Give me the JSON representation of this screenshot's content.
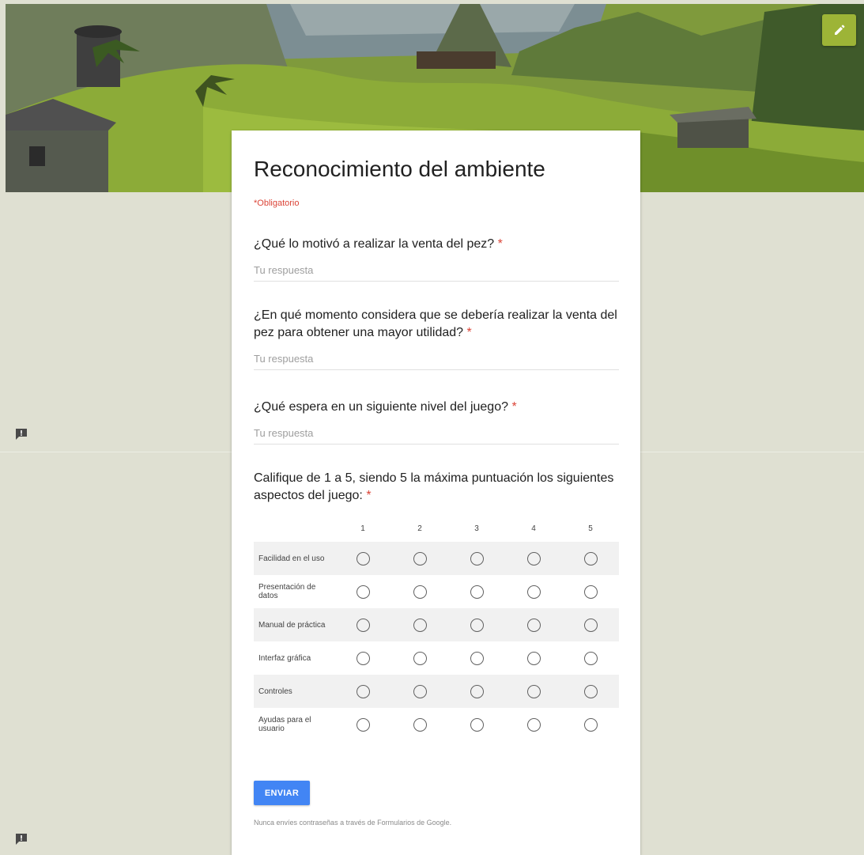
{
  "header": {
    "edit_icon": "pencil-icon",
    "accent_color": "#9db437"
  },
  "form": {
    "title": "Reconocimiento del ambiente",
    "required_note": "*Obligatorio",
    "questions": [
      {
        "title": "¿Qué lo motivó a realizar la venta del pez?",
        "required_mark": "*",
        "placeholder": "Tu respuesta"
      },
      {
        "title": "¿En qué momento considera que se debería realizar la venta del pez para obtener una mayor utilidad?",
        "required_mark": "*",
        "placeholder": "Tu respuesta"
      },
      {
        "title": "¿Qué espera en un siguiente nivel del juego?",
        "required_mark": "*",
        "placeholder": "Tu respuesta"
      }
    ],
    "grid_question": {
      "title": "Califique de 1 a 5, siendo 5 la máxima puntuación los siguientes aspectos del juego:",
      "required_mark": "*",
      "columns": [
        "1",
        "2",
        "3",
        "4",
        "5"
      ],
      "rows": [
        "Facilidad en el uso",
        "Presentación de datos",
        "Manual de práctica",
        "Interfaz gráfica",
        "Controles",
        "Ayudas para el usuario"
      ]
    },
    "submit_label": "ENVIAR",
    "footer_note": "Nunca envíes contraseñas a través de Formularios de Google.",
    "colors": {
      "submit": "#4285f4",
      "required": "#db4437",
      "background": "#dfe0d2"
    }
  },
  "side": {
    "feedback_icon": "feedback-icon"
  }
}
